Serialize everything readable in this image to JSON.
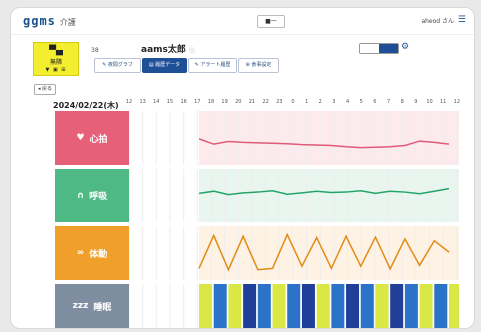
{
  "header": {
    "logo": "ggms",
    "site": "介護",
    "select": "■一",
    "user": "aheod さん"
  },
  "resident": {
    "status": "無隣",
    "room": "38",
    "name": "aams太郎",
    "edit_icon": "◎"
  },
  "tabs": [
    {
      "label": "✎ 夜間グラフ",
      "active": false
    },
    {
      "label": "▤ 履歴データ",
      "active": true
    },
    {
      "label": "✎ アラート履歴",
      "active": false
    },
    {
      "label": "⊕ 食事設定",
      "active": false
    }
  ],
  "controls": {
    "back": "◂ 戻る"
  },
  "date": "2024/02/22(木)",
  "hours": [
    "12",
    "13",
    "14",
    "15",
    "16",
    "17",
    "18",
    "19",
    "20",
    "21",
    "22",
    "23",
    "0",
    "1",
    "2",
    "3",
    "4",
    "5",
    "6",
    "7",
    "8",
    "9",
    "10",
    "11",
    "12"
  ],
  "sections": [
    {
      "name": "心拍",
      "icon": "♥",
      "color": "#e7607a"
    },
    {
      "name": "呼吸",
      "icon": "∩",
      "color": "#4fb985"
    },
    {
      "name": "体動",
      "icon": "∞",
      "color": "#f0a02a"
    },
    {
      "name": "睡眠",
      "icon": "zzz",
      "color": "#7f8da1"
    }
  ],
  "chart_data": [
    {
      "type": "line",
      "title": "心拍",
      "x": [
        7,
        8,
        9,
        10,
        11,
        12,
        13,
        14,
        15,
        16,
        17,
        18,
        19,
        20,
        21,
        22,
        23,
        24
      ],
      "series": [
        {
          "values": [
            0.48,
            0.36,
            0.42,
            0.4,
            0.39,
            0.38,
            0.37,
            0.35,
            0.34,
            0.33,
            0.3,
            0.28,
            0.29,
            0.3,
            0.33,
            0.43,
            0.4,
            0.36
          ]
        }
      ],
      "ylim": [
        0,
        1
      ],
      "grid": true
    },
    {
      "type": "line",
      "title": "呼吸",
      "x": [
        7,
        8,
        9,
        10,
        11,
        12,
        13,
        14,
        15,
        16,
        17,
        18,
        19,
        20,
        21,
        22,
        23,
        24
      ],
      "series": [
        {
          "values": [
            0.55,
            0.6,
            0.52,
            0.56,
            0.58,
            0.61,
            0.53,
            0.56,
            0.6,
            0.57,
            0.58,
            0.61,
            0.55,
            0.6,
            0.58,
            0.54,
            0.6,
            0.66
          ]
        }
      ],
      "ylim": [
        0,
        1
      ],
      "grid": true
    },
    {
      "type": "line",
      "title": "体動",
      "x": [
        7,
        8,
        9,
        10,
        11,
        12,
        13,
        14,
        15,
        16,
        17,
        18,
        19,
        20,
        21,
        22,
        23,
        24
      ],
      "series": [
        {
          "values": [
            0.15,
            0.9,
            0.12,
            0.88,
            0.12,
            0.15,
            0.92,
            0.2,
            0.85,
            0.15,
            0.88,
            0.2,
            0.86,
            0.14,
            0.82,
            0.22,
            0.78,
            0.52
          ]
        }
      ],
      "ylim": [
        0,
        1
      ],
      "grid": true
    },
    {
      "type": "heatmap",
      "title": "睡眠",
      "x": [
        7,
        8,
        9,
        10,
        11,
        12,
        13,
        14,
        15,
        16,
        17,
        18,
        19,
        20,
        21,
        22,
        23,
        24
      ],
      "values": [
        1,
        2,
        1,
        3,
        2,
        1,
        2,
        3,
        1,
        2,
        3,
        2,
        1,
        3,
        2,
        1,
        2,
        1
      ],
      "colors": {
        "1": "#d9e845",
        "2": "#2b72c9",
        "3": "#1f3f98"
      }
    }
  ]
}
